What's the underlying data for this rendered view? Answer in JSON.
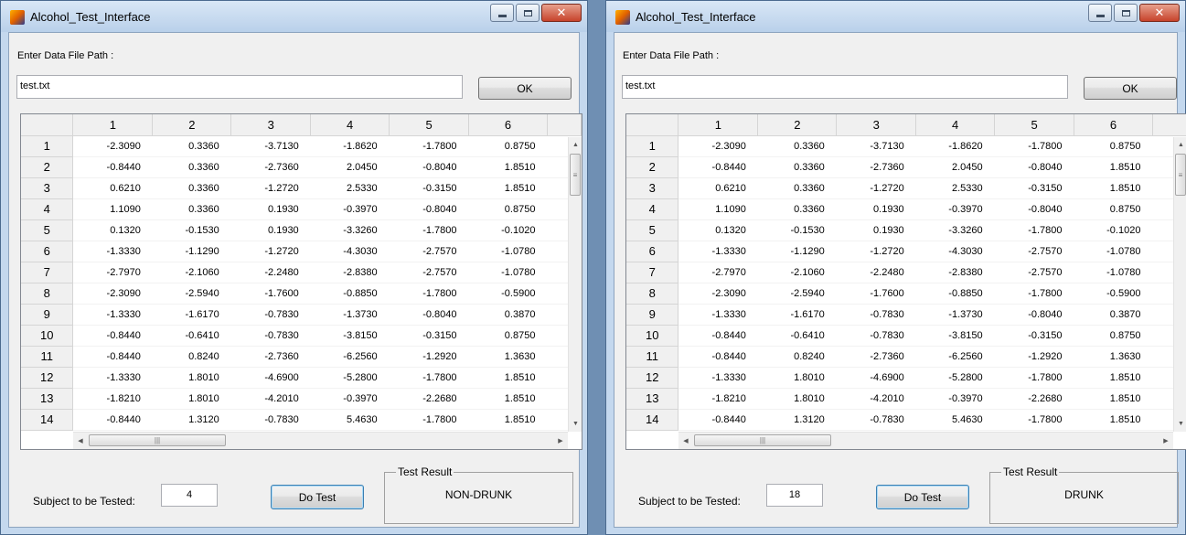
{
  "columns": [
    "1",
    "2",
    "3",
    "4",
    "5",
    "6"
  ],
  "rows": [
    {
      "label": "1",
      "values": [
        "-2.3090",
        "0.3360",
        "-3.7130",
        "-1.8620",
        "-1.7800",
        "0.8750"
      ]
    },
    {
      "label": "2",
      "values": [
        "-0.8440",
        "0.3360",
        "-2.7360",
        "2.0450",
        "-0.8040",
        "1.8510"
      ]
    },
    {
      "label": "3",
      "values": [
        "0.6210",
        "0.3360",
        "-1.2720",
        "2.5330",
        "-0.3150",
        "1.8510"
      ]
    },
    {
      "label": "4",
      "values": [
        "1.1090",
        "0.3360",
        "0.1930",
        "-0.3970",
        "-0.8040",
        "0.8750"
      ]
    },
    {
      "label": "5",
      "values": [
        "0.1320",
        "-0.1530",
        "0.1930",
        "-3.3260",
        "-1.7800",
        "-0.1020"
      ]
    },
    {
      "label": "6",
      "values": [
        "-1.3330",
        "-1.1290",
        "-1.2720",
        "-4.3030",
        "-2.7570",
        "-1.0780"
      ]
    },
    {
      "label": "7",
      "values": [
        "-2.7970",
        "-2.1060",
        "-2.2480",
        "-2.8380",
        "-2.7570",
        "-1.0780"
      ]
    },
    {
      "label": "8",
      "values": [
        "-2.3090",
        "-2.5940",
        "-1.7600",
        "-0.8850",
        "-1.7800",
        "-0.5900"
      ]
    },
    {
      "label": "9",
      "values": [
        "-1.3330",
        "-1.6170",
        "-0.7830",
        "-1.3730",
        "-0.8040",
        "0.3870"
      ]
    },
    {
      "label": "10",
      "values": [
        "-0.8440",
        "-0.6410",
        "-0.7830",
        "-3.8150",
        "-0.3150",
        "0.8750"
      ]
    },
    {
      "label": "11",
      "values": [
        "-0.8440",
        "0.8240",
        "-2.7360",
        "-6.2560",
        "-1.2920",
        "1.3630"
      ]
    },
    {
      "label": "12",
      "values": [
        "-1.3330",
        "1.8010",
        "-4.6900",
        "-5.2800",
        "-1.7800",
        "1.8510"
      ]
    },
    {
      "label": "13",
      "values": [
        "-1.8210",
        "1.8010",
        "-4.2010",
        "-0.3970",
        "-2.2680",
        "1.8510"
      ]
    },
    {
      "label": "14",
      "values": [
        "-0.8440",
        "1.3120",
        "-0.7830",
        "5.4630",
        "-1.7800",
        "1.8510"
      ]
    }
  ],
  "icons": {
    "app": "matlab-logo-icon",
    "minimize": "minimize-icon",
    "maximize": "maximize-icon",
    "close": "close-icon",
    "scroll_up": "arrow-up-icon",
    "scroll_down": "arrow-down-icon",
    "scroll_left": "arrow-left-icon",
    "scroll_right": "arrow-right-icon"
  },
  "windows": [
    {
      "title": "Alcohol_Test_Interface",
      "path_label": "Enter Data File Path :",
      "path_value": "test.txt",
      "ok_label": "OK",
      "subject_label": "Subject to be Tested:",
      "subject_value": "4",
      "test_button_label": "Do Test",
      "result_title": "Test Result",
      "result_value": "NON-DRUNK"
    },
    {
      "title": "Alcohol_Test_Interface",
      "path_label": "Enter Data File Path :",
      "path_value": "test.txt",
      "ok_label": "OK",
      "subject_label": "Subject to be Tested:",
      "subject_value": "18",
      "test_button_label": "Do Test",
      "result_title": "Test Result",
      "result_value": "DRUNK"
    }
  ]
}
